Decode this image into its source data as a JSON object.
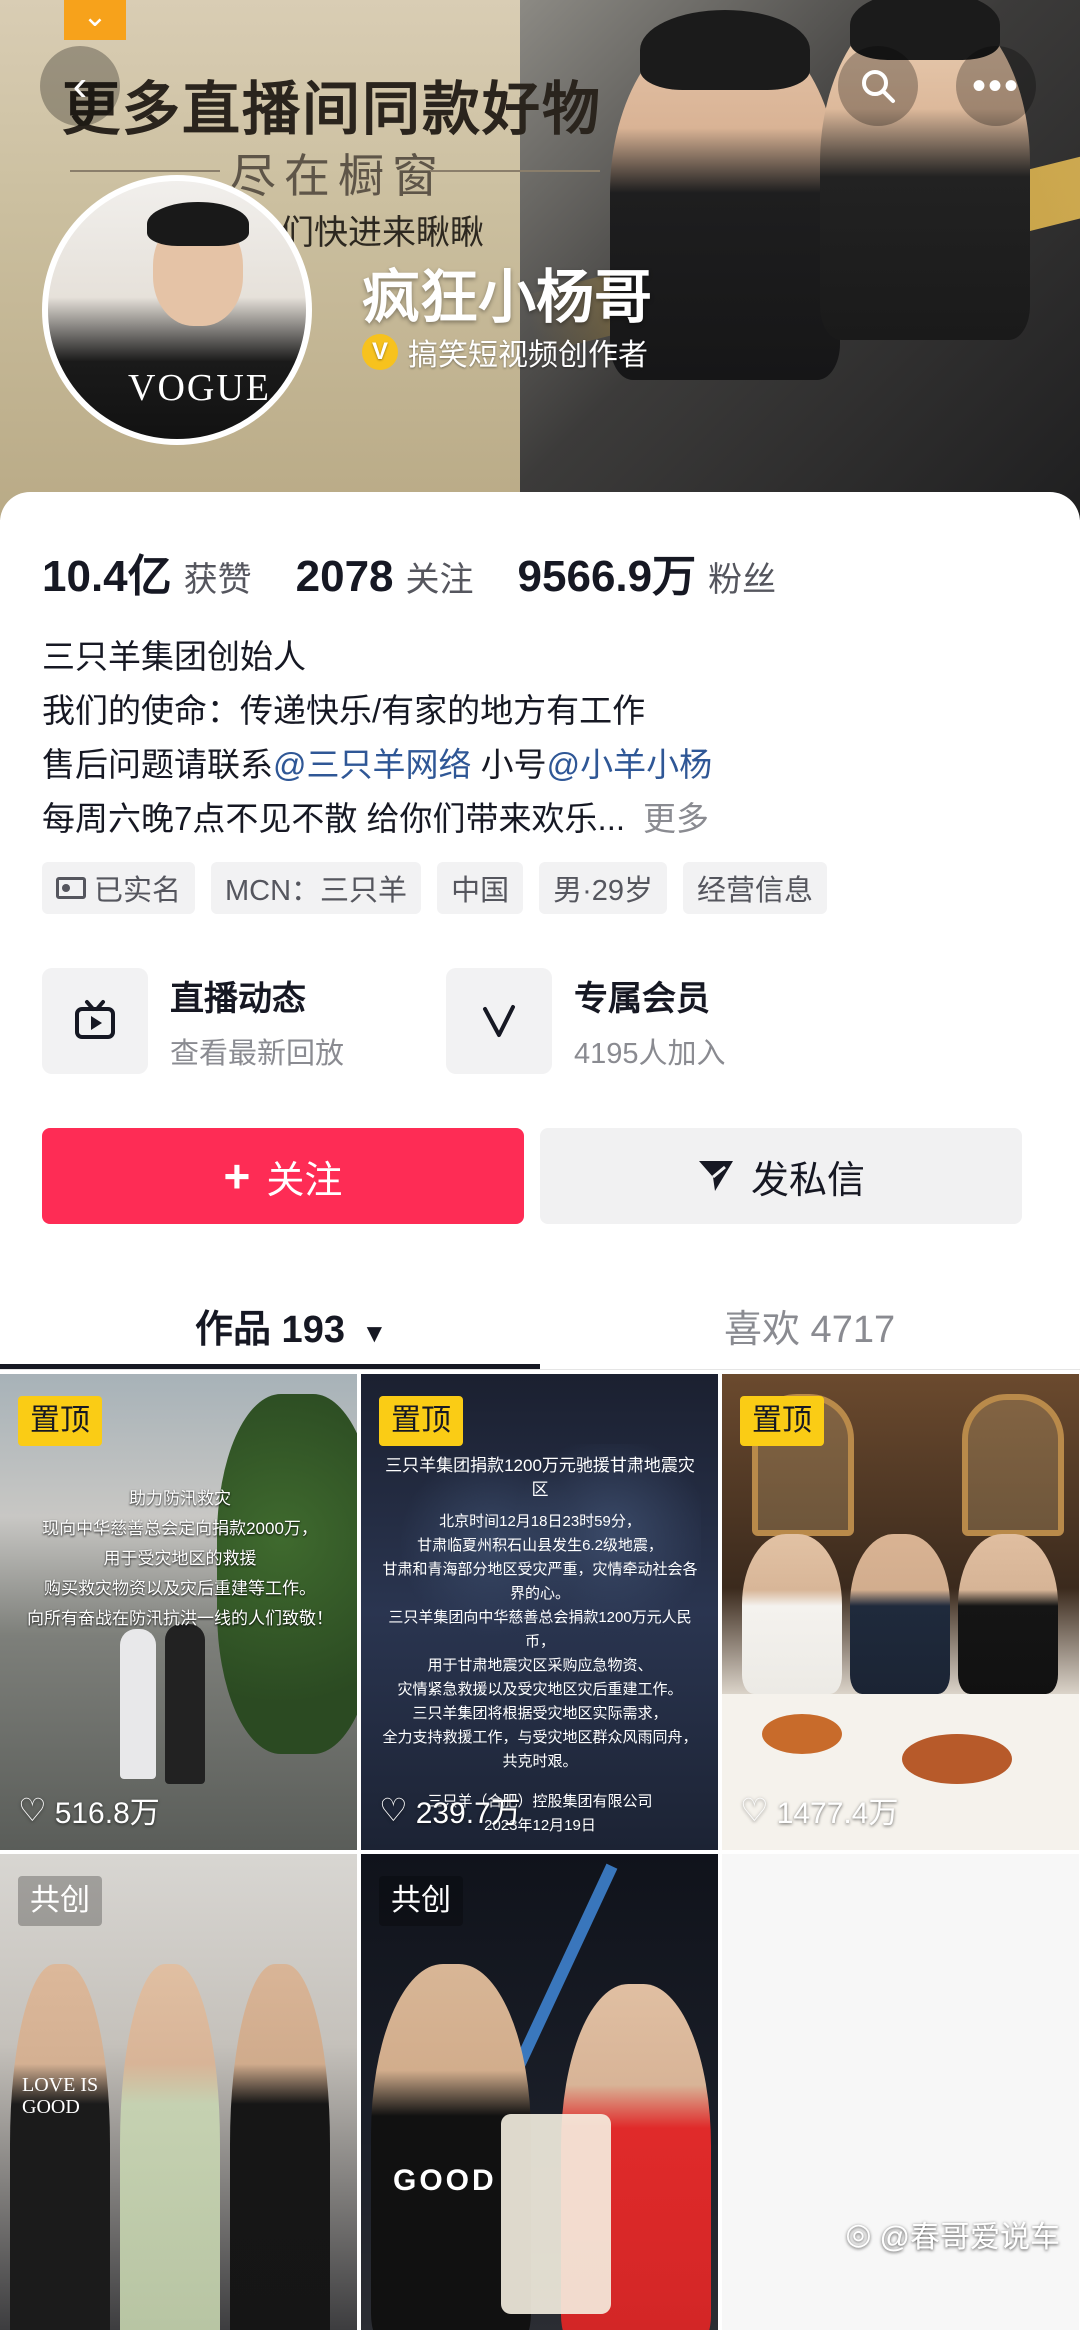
{
  "banner": {
    "promo_title": "更多直播间同款好物",
    "promo_subtitle": "尽在橱窗",
    "promo_hint": "们快进来瞅瞅",
    "promo_badge_icon": "chevron-down-icon"
  },
  "profile": {
    "name": "疯狂小杨哥",
    "verify_badge": "V",
    "verify_text": "搞笑短视频创作者",
    "avatar_logo": "VOGUE"
  },
  "stats": [
    {
      "num": "10.4亿",
      "label": "获赞"
    },
    {
      "num": "2078",
      "label": "关注"
    },
    {
      "num": "9566.9万",
      "label": "粉丝"
    }
  ],
  "bio": {
    "line1": "三只羊集团创始人",
    "line2": "我们的使命：传递快乐/有家的地方有工作",
    "line3_prefix": "售后问题请联系",
    "line3_mention1": "@三只羊网络",
    "line3_mid": " 小号",
    "line3_mention2": "@小羊小杨",
    "line4": "每周六晚7点不见不散  给你们带来欢乐...",
    "more": "更多"
  },
  "tags": [
    "已实名",
    "MCN：三只羊",
    "中国",
    "男·29岁",
    "经营信息"
  ],
  "features": [
    {
      "title": "直播动态",
      "sub": "查看最新回放",
      "icon": "tv-icon"
    },
    {
      "title": "专属会员",
      "sub": "4195人加入",
      "icon": "v-icon"
    }
  ],
  "actions": {
    "follow": "关注",
    "message": "发私信"
  },
  "tabs": {
    "works": "作品 193",
    "likes": "喜欢 4717"
  },
  "videos": [
    {
      "badge": "置顶",
      "likes": "516.8万",
      "text": [
        "助力防汛救灾",
        "现向中华慈善总会定向捐款2000万，",
        "用于受灾地区的救援",
        "购买救灾物资以及灾后重建等工作。",
        "向所有奋战在防汛抗洪一线的人们致敬！"
      ]
    },
    {
      "badge": "置顶",
      "likes": "239.7万",
      "title": "三只羊集团捐款1200万元驰援甘肃地震灾区",
      "text": [
        "北京时间12月18日23时59分，",
        "甘肃临夏州积石山县发生6.2级地震，",
        "甘肃和青海部分地区受灾严重，灾情牵动社会各界的心。",
        "三只羊集团向中华慈善总会捐款1200万元人民币，",
        "用于甘肃地震灾区采购应急物资、",
        "灾情紧急救援以及受灾地区灾后重建工作。",
        "三只羊集团将根据受灾地区实际需求，",
        "全力支持救援工作，与受灾地区群众风雨同舟，",
        "共克时艰。"
      ],
      "signature": "三只羊（合肥）控股集团有限公司",
      "date": "2023年12月19日"
    },
    {
      "badge": "置顶",
      "likes": "1477.4万"
    },
    {
      "badge": "共创",
      "shirt_text": "LOVE IS GOOD"
    },
    {
      "badge": "共创",
      "shirt_text": "GOOD"
    }
  ],
  "watermark": "@春哥爱说车",
  "colors": {
    "follow_button": "#fe2c55",
    "mention": "#2f5796",
    "pin_badge": "#facc15"
  }
}
